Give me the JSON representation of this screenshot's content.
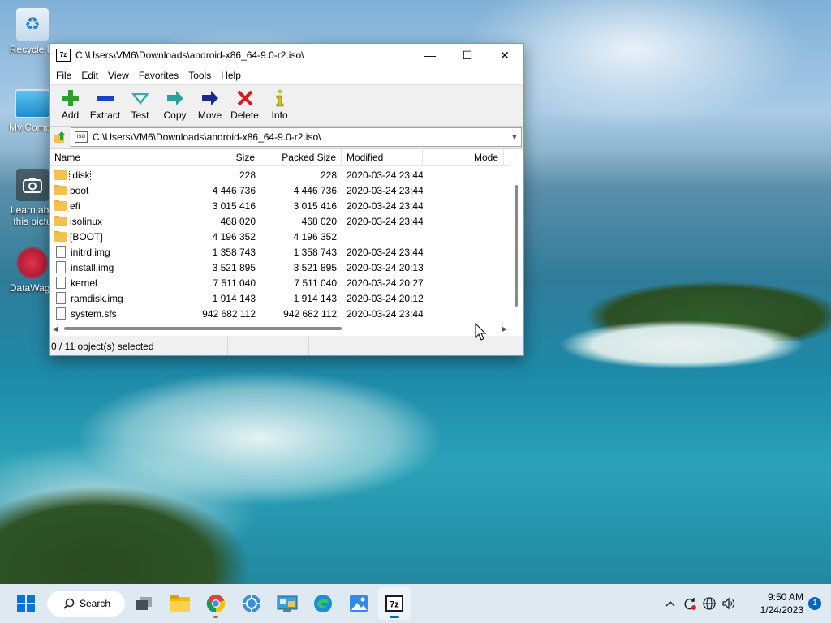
{
  "desktop": {
    "icons": [
      {
        "label": "Recycle Bi",
        "icon": "recycle-bin-icon"
      },
      {
        "label": "My Compu",
        "icon": "computer-icon"
      },
      {
        "label": "Learn abo",
        "label2": "this pictu",
        "icon": "camera-icon"
      },
      {
        "label": "DataWago",
        "icon": "datawagon-icon"
      }
    ]
  },
  "window": {
    "title": "C:\\Users\\VM6\\Downloads\\android-x86_64-9.0-r2.iso\\",
    "app_icon_text": "7z",
    "controls": {
      "minimize": "—",
      "maximize": "☐",
      "close": "✕"
    },
    "menu": [
      "File",
      "Edit",
      "View",
      "Favorites",
      "Tools",
      "Help"
    ],
    "toolbar": [
      {
        "label": "Add",
        "icon": "add-icon",
        "color": "#2e9e2e"
      },
      {
        "label": "Extract",
        "icon": "extract-icon",
        "color": "#1f3fbf"
      },
      {
        "label": "Test",
        "icon": "test-icon",
        "color": "#2bb3b3"
      },
      {
        "label": "Copy",
        "icon": "copy-icon",
        "color": "#2aa39a"
      },
      {
        "label": "Move",
        "icon": "move-icon",
        "color": "#1a2a8c"
      },
      {
        "label": "Delete",
        "icon": "delete-icon",
        "color": "#d61c1c"
      },
      {
        "label": "Info",
        "icon": "info-icon",
        "color": "#d1c21c"
      }
    ],
    "address": "C:\\Users\\VM6\\Downloads\\android-x86_64-9.0-r2.iso\\",
    "columns": {
      "name": "Name",
      "size": "Size",
      "packed": "Packed Size",
      "modified": "Modified",
      "mode": "Mode"
    },
    "rows": [
      {
        "name": ".disk",
        "type": "folder",
        "size": "228",
        "packed": "228",
        "modified": "2020-03-24 23:44"
      },
      {
        "name": "boot",
        "type": "folder",
        "size": "4 446 736",
        "packed": "4 446 736",
        "modified": "2020-03-24 23:44"
      },
      {
        "name": "efi",
        "type": "folder",
        "size": "3 015 416",
        "packed": "3 015 416",
        "modified": "2020-03-24 23:44"
      },
      {
        "name": "isolinux",
        "type": "folder",
        "size": "468 020",
        "packed": "468 020",
        "modified": "2020-03-24 23:44"
      },
      {
        "name": "[BOOT]",
        "type": "folder",
        "size": "4 196 352",
        "packed": "4 196 352",
        "modified": ""
      },
      {
        "name": "initrd.img",
        "type": "file",
        "size": "1 358 743",
        "packed": "1 358 743",
        "modified": "2020-03-24 23:44"
      },
      {
        "name": "install.img",
        "type": "file",
        "size": "3 521 895",
        "packed": "3 521 895",
        "modified": "2020-03-24 20:13"
      },
      {
        "name": "kernel",
        "type": "file",
        "size": "7 511 040",
        "packed": "7 511 040",
        "modified": "2020-03-24 20:27"
      },
      {
        "name": "ramdisk.img",
        "type": "file",
        "size": "1 914 143",
        "packed": "1 914 143",
        "modified": "2020-03-24 20:12"
      },
      {
        "name": "system.sfs",
        "type": "file",
        "size": "942 682 112",
        "packed": "942 682 112",
        "modified": "2020-03-24 23:44"
      }
    ],
    "status": "0 / 11 object(s) selected"
  },
  "taskbar": {
    "search_label": "Search",
    "clock_time": "9:50 AM",
    "clock_date": "1/24/2023",
    "notification_count": "1"
  }
}
